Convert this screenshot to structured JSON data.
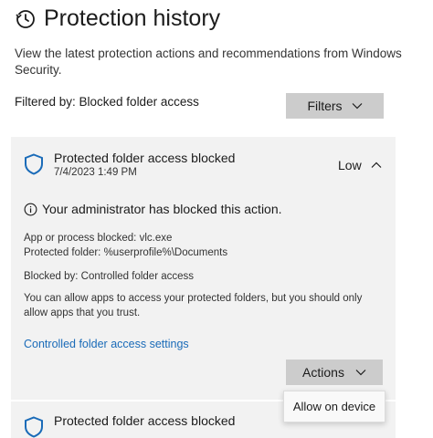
{
  "page": {
    "title": "Protection history",
    "description": "View the latest protection actions and recommendations from Windows Security.",
    "filtered_by": "Filtered by: Blocked folder access",
    "filters_label": "Filters"
  },
  "entries": [
    {
      "title": "Protected folder access blocked",
      "date": "7/4/2023 1:49 PM",
      "severity": "Low",
      "admin_notice": "Your administrator has blocked this action.",
      "app_blocked": "App or process blocked:  vlc.exe",
      "protected_folder": "Protected folder:  %userprofile%\\Documents",
      "blocked_by": "Blocked by:  Controlled folder access",
      "explanation_line1": "You can allow apps to access your protected folders, but you should only",
      "explanation_line2": "allow apps that you trust.",
      "settings_link": "Controlled folder access settings",
      "actions_label": "Actions",
      "menu_items": [
        "Allow on device"
      ]
    },
    {
      "title": "Protected folder access blocked"
    }
  ],
  "icons": {
    "history": "history-icon",
    "shield": "shield-icon",
    "info": "info-icon",
    "chevron_down": "chevron-down-icon",
    "chevron_up": "chevron-up-icon"
  },
  "colors": {
    "accent_link": "#1a6bb8",
    "shield": "#1a6bb8",
    "button_bg": "#cccccc",
    "card_bg": "#f2f2f2"
  }
}
